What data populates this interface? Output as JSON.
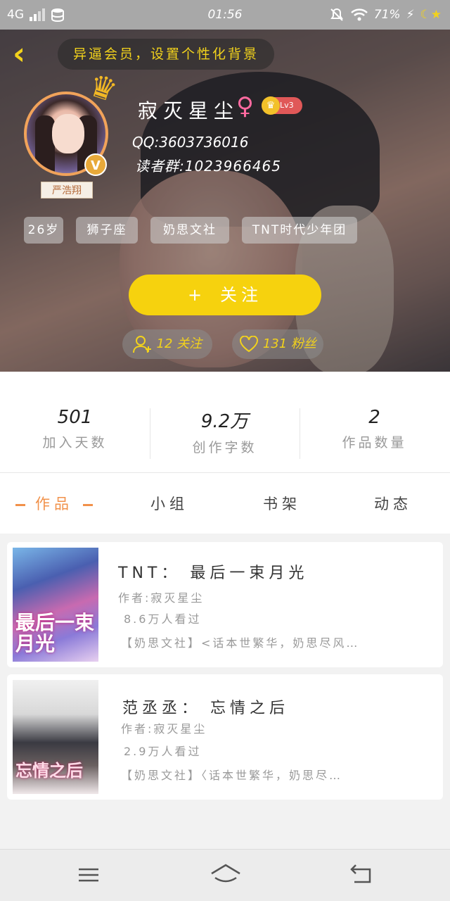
{
  "status_bar": {
    "network": "4G",
    "time": "01:56",
    "battery": "71%"
  },
  "header": {
    "notice": "异逼会员，设置个性化背景"
  },
  "profile": {
    "name": "寂灭星尘",
    "level": "Lv3",
    "vip_badge": "V",
    "nameplate": "严浩翔",
    "qq": "QQ:3603736016",
    "readers_group": "读者群:1023966465",
    "tags": [
      "26岁",
      "狮子座",
      "奶思文社",
      "TNT时代少年团"
    ],
    "follow_button": "关注",
    "follow_button_icon": "+",
    "following": "12 关注",
    "fans": "131 粉丝"
  },
  "stats": [
    {
      "value": "501",
      "label": "加入天数"
    },
    {
      "value": "9.2万",
      "label": "创作字数"
    },
    {
      "value": "2",
      "label": "作品数量"
    }
  ],
  "tabs": [
    {
      "label": "作品",
      "active": true
    },
    {
      "label": "小组",
      "active": false
    },
    {
      "label": "书架",
      "active": false
    },
    {
      "label": "动态",
      "active": false
    }
  ],
  "books": [
    {
      "title": "TNT： 最后一束月光",
      "author": "作者:寂灭星尘",
      "views": "8.6万人看过",
      "intro": "【奶思文社】<话本世繁华，奶思尽风…",
      "cover_text": "最后一束月光"
    },
    {
      "title": "范丞丞： 忘情之后",
      "author": "作者:寂灭星尘",
      "views": "2.9万人看过",
      "intro": "【奶思文社】〈话本世繁华，奶思尽…",
      "cover_text": "忘情之后"
    }
  ],
  "colors": {
    "accent": "#f6d20e",
    "tab_active": "#f1914a",
    "level_badge": "#e05858"
  }
}
